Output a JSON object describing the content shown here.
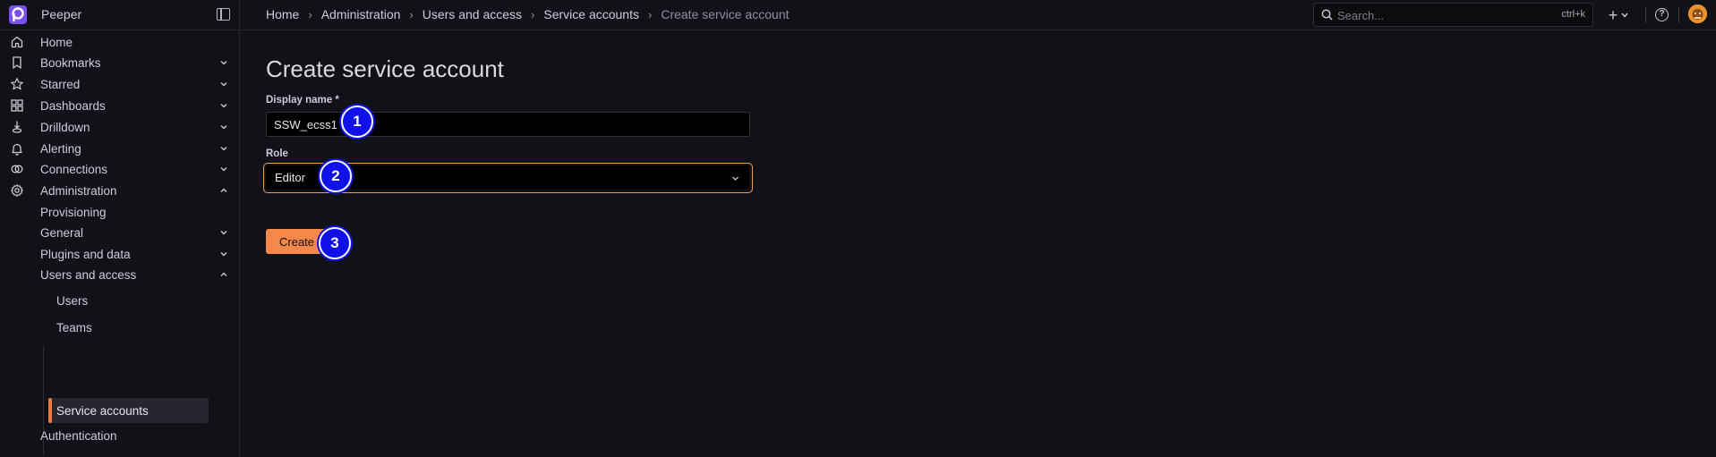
{
  "app": {
    "name": "Peeper"
  },
  "breadcrumb": [
    "Home",
    "Administration",
    "Users and access",
    "Service accounts",
    "Create service account"
  ],
  "search": {
    "placeholder": "Search...",
    "shortcut": "ctrl+k"
  },
  "sidebar": {
    "items": [
      {
        "label": "Home",
        "icon": "home-icon",
        "chevron": false
      },
      {
        "label": "Bookmarks",
        "icon": "bookmark-icon",
        "chevron": "down"
      },
      {
        "label": "Starred",
        "icon": "star-icon",
        "chevron": "down"
      },
      {
        "label": "Dashboards",
        "icon": "dashboards-grid-icon",
        "chevron": "down"
      },
      {
        "label": "Drilldown",
        "icon": "drilldown-icon",
        "chevron": "down"
      },
      {
        "label": "Alerting",
        "icon": "bell-icon",
        "chevron": "down"
      },
      {
        "label": "Connections",
        "icon": "connections-icon",
        "chevron": "down"
      },
      {
        "label": "Administration",
        "icon": "gear-icon",
        "chevron": "up"
      }
    ],
    "admin_children": [
      {
        "label": "Provisioning",
        "chevron": false
      },
      {
        "label": "General",
        "chevron": "down"
      },
      {
        "label": "Plugins and data",
        "chevron": "down"
      },
      {
        "label": "Users and access",
        "chevron": "up"
      }
    ],
    "users_children": [
      "Users",
      "Teams",
      "Service accounts"
    ],
    "after": "Authentication",
    "active": "Service accounts"
  },
  "form": {
    "title": "Create service account",
    "display_name_label": "Display name *",
    "display_name_value": "SSW_ecss1",
    "role_label": "Role",
    "role_value": "Editor",
    "create_label": "Create"
  },
  "annotations": [
    "1",
    "2",
    "3"
  ],
  "colors": {
    "accent": "#f5884a",
    "focus_border": "#f5994f",
    "badge": "#1010e8",
    "background": "#111217"
  }
}
